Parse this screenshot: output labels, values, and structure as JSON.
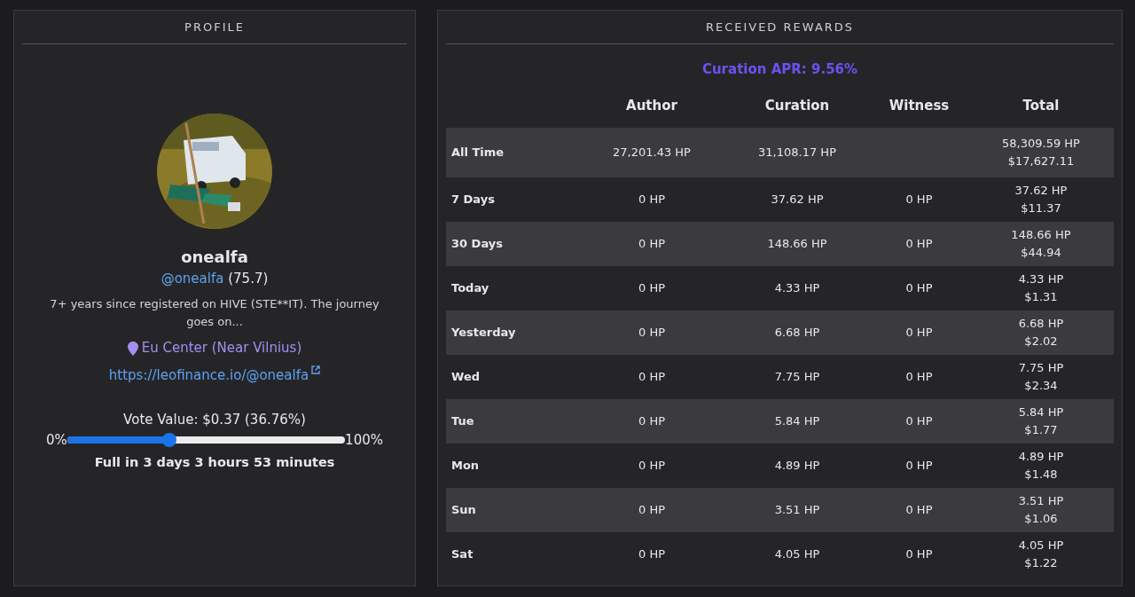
{
  "profile": {
    "heading": "PROFILE",
    "name": "onealfa",
    "handle": "@onealfa",
    "reputation": "(75.7)",
    "about": "7+ years since registered on HIVE (STE**IT). The journey goes on...",
    "location": "Eu Center (Near Vilnius)",
    "website": "https://leofinance.io/@onealfa",
    "vote_value": "Vote Value: $0.37 (36.76%)",
    "vote_slider": {
      "min_label": "0%",
      "max_label": "100%",
      "level": 0.3676
    },
    "recharge": "Full in 3 days 3 hours 53 minutes"
  },
  "rewards": {
    "heading": "RECEIVED REWARDS",
    "curation_apr": "Curation APR: 9.56%",
    "columns": [
      "Author",
      "Curation",
      "Witness",
      "Total"
    ],
    "rows": [
      {
        "period": "All Time",
        "author": "27,201.43 HP",
        "curation": "31,108.17 HP",
        "total_hp": "58,309.59 HP",
        "total_usd": "$17,627.11"
      },
      {
        "period": "7 Days",
        "author": "0 HP",
        "curation": "37.62 HP",
        "witness": "0 HP",
        "total_hp": "37.62 HP",
        "total_usd": "$11.37"
      },
      {
        "period": "30 Days",
        "author": "0 HP",
        "curation": "148.66 HP",
        "witness": "0 HP",
        "total_hp": "148.66 HP",
        "total_usd": "$44.94"
      },
      {
        "period": "Today",
        "author": "0 HP",
        "curation": "4.33 HP",
        "witness": "0 HP",
        "total_hp": "4.33 HP",
        "total_usd": "$1.31"
      },
      {
        "period": "Yesterday",
        "author": "0 HP",
        "curation": "6.68 HP",
        "witness": "0 HP",
        "total_hp": "6.68 HP",
        "total_usd": "$2.02"
      },
      {
        "period": "Wed",
        "author": "0 HP",
        "curation": "7.75 HP",
        "witness": "0 HP",
        "total_hp": "7.75 HP",
        "total_usd": "$2.34"
      },
      {
        "period": "Tue",
        "author": "0 HP",
        "curation": "5.84 HP",
        "witness": "0 HP",
        "total_hp": "5.84 HP",
        "total_usd": "$1.77"
      },
      {
        "period": "Mon",
        "author": "0 HP",
        "curation": "4.89 HP",
        "witness": "0 HP",
        "total_hp": "4.89 HP",
        "total_usd": "$1.48"
      },
      {
        "period": "Sun",
        "author": "0 HP",
        "curation": "3.51 HP",
        "witness": "0 HP",
        "total_hp": "3.51 HP",
        "total_usd": "$1.06"
      },
      {
        "period": "Sat",
        "author": "0 HP",
        "curation": "4.05 HP",
        "witness": "0 HP",
        "total_hp": "4.05 HP",
        "total_usd": "$1.22"
      }
    ]
  }
}
